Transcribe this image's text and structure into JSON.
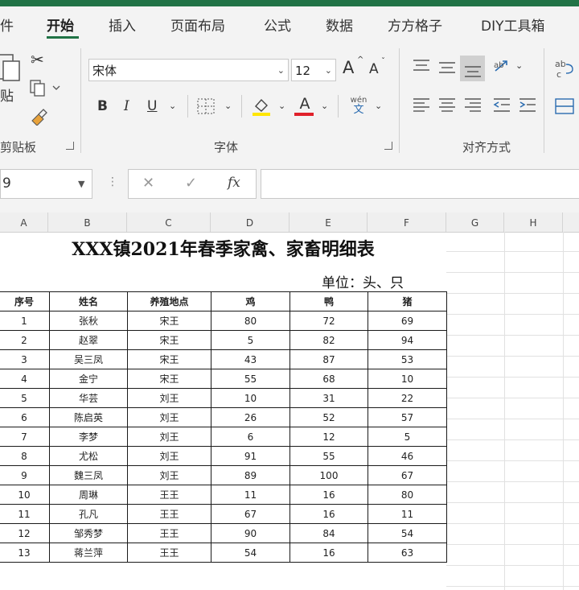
{
  "ribbon_tabs": [
    "件",
    "开始",
    "插入",
    "页面布局",
    "公式",
    "数据",
    "方方格子",
    "DIY工具箱"
  ],
  "ribbon": {
    "paste_label": "贴",
    "font_name": "宋体",
    "font_size": "12",
    "bold": "B",
    "italic": "I",
    "underline": "U",
    "font_color_letter": "A",
    "phonetic_top": "wén",
    "phonetic_bottom": "文",
    "grow_font": "A",
    "shrink_font": "A",
    "groups": {
      "clipboard": "剪贴板",
      "font": "字体",
      "alignment": "对齐方式"
    },
    "highlight_color": "#ffe600",
    "font_color": "#e0202a"
  },
  "formula_bar": {
    "name_box": "9",
    "cancel": "✕",
    "confirm": "✓",
    "fx": "fx",
    "formula": ""
  },
  "columns": [
    "A",
    "B",
    "C",
    "D",
    "E",
    "F",
    "G",
    "H"
  ],
  "sheet": {
    "title": "XXX镇2021年春季家禽、家畜明细表",
    "unit": "单位：头、只",
    "headers": [
      "序号",
      "姓名",
      "养殖地点",
      "鸡",
      "鸭",
      "猪"
    ],
    "rows": [
      [
        "1",
        "张秋",
        "宋王",
        "80",
        "72",
        "69"
      ],
      [
        "2",
        "赵翠",
        "宋王",
        "5",
        "82",
        "94"
      ],
      [
        "3",
        "吴三凤",
        "宋王",
        "43",
        "87",
        "53"
      ],
      [
        "4",
        "金宁",
        "宋王",
        "55",
        "68",
        "10"
      ],
      [
        "5",
        "华芸",
        "刘王",
        "10",
        "31",
        "22"
      ],
      [
        "6",
        "陈启英",
        "刘王",
        "26",
        "52",
        "57"
      ],
      [
        "7",
        "李梦",
        "刘王",
        "6",
        "12",
        "5"
      ],
      [
        "8",
        "尤松",
        "刘王",
        "91",
        "55",
        "46"
      ],
      [
        "9",
        "魏三凤",
        "刘王",
        "89",
        "100",
        "67"
      ],
      [
        "10",
        "周琳",
        "王王",
        "11",
        "16",
        "80"
      ],
      [
        "11",
        "孔凡",
        "王王",
        "67",
        "16",
        "11"
      ],
      [
        "12",
        "邹秀梦",
        "王王",
        "90",
        "84",
        "54"
      ],
      [
        "13",
        "蒋兰萍",
        "王王",
        "54",
        "16",
        "63"
      ]
    ]
  }
}
